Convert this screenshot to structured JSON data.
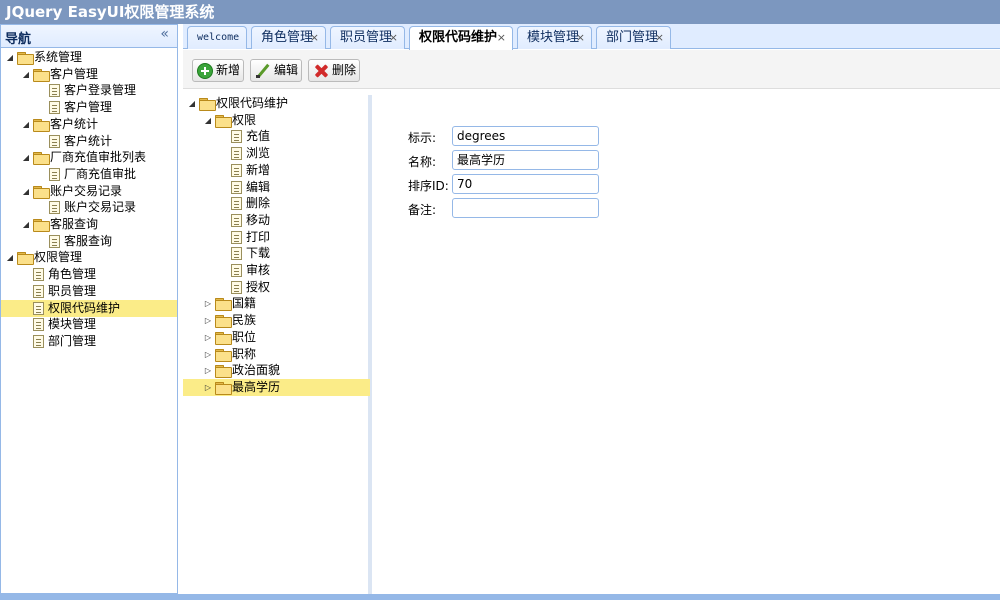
{
  "app": {
    "title": "JQuery EasyUI权限管理系统"
  },
  "nav": {
    "title": "导航",
    "collapse_icon": "double-chevron-left-icon",
    "tree": [
      {
        "label": "系统管理",
        "level": 0,
        "type": "folder",
        "expanded": true
      },
      {
        "label": "客户管理",
        "level": 1,
        "type": "folder",
        "expanded": true
      },
      {
        "label": "客户登录管理",
        "level": 2,
        "type": "leaf"
      },
      {
        "label": "客户管理",
        "level": 2,
        "type": "leaf"
      },
      {
        "label": "客户统计",
        "level": 1,
        "type": "folder",
        "expanded": true
      },
      {
        "label": "客户统计",
        "level": 2,
        "type": "leaf"
      },
      {
        "label": "厂商充值审批列表",
        "level": 1,
        "type": "folder",
        "expanded": true
      },
      {
        "label": "厂商充值审批",
        "level": 2,
        "type": "leaf"
      },
      {
        "label": "账户交易记录",
        "level": 1,
        "type": "folder",
        "expanded": true
      },
      {
        "label": "账户交易记录",
        "level": 2,
        "type": "leaf"
      },
      {
        "label": "客服查询",
        "level": 1,
        "type": "folder",
        "expanded": true
      },
      {
        "label": "客服查询",
        "level": 2,
        "type": "leaf"
      },
      {
        "label": "权限管理",
        "level": 0,
        "type": "folder",
        "expanded": true
      },
      {
        "label": "角色管理",
        "level": 1,
        "type": "leaf"
      },
      {
        "label": "职员管理",
        "level": 1,
        "type": "leaf"
      },
      {
        "label": "权限代码维护",
        "level": 1,
        "type": "leaf",
        "selected": true
      },
      {
        "label": "模块管理",
        "level": 1,
        "type": "leaf"
      },
      {
        "label": "部门管理",
        "level": 1,
        "type": "leaf"
      }
    ]
  },
  "tabs": [
    {
      "label": "welcome",
      "closable": false
    },
    {
      "label": "角色管理",
      "closable": true
    },
    {
      "label": "职员管理",
      "closable": true
    },
    {
      "label": "权限代码维护",
      "closable": true,
      "active": true
    },
    {
      "label": "模块管理",
      "closable": true
    },
    {
      "label": "部门管理",
      "closable": true
    }
  ],
  "tab_close_symbol": "×",
  "toolbar": {
    "add_label": "新增",
    "edit_label": "编辑",
    "delete_label": "删除"
  },
  "code_tree": [
    {
      "label": "权限代码维护",
      "level": 0,
      "type": "folder",
      "expanded": true
    },
    {
      "label": "权限",
      "level": 1,
      "type": "folder",
      "expanded": true
    },
    {
      "label": "充值",
      "level": 2,
      "type": "leaf"
    },
    {
      "label": "浏览",
      "level": 2,
      "type": "leaf"
    },
    {
      "label": "新增",
      "level": 2,
      "type": "leaf"
    },
    {
      "label": "编辑",
      "level": 2,
      "type": "leaf"
    },
    {
      "label": "删除",
      "level": 2,
      "type": "leaf"
    },
    {
      "label": "移动",
      "level": 2,
      "type": "leaf"
    },
    {
      "label": "打印",
      "level": 2,
      "type": "leaf"
    },
    {
      "label": "下载",
      "level": 2,
      "type": "leaf"
    },
    {
      "label": "审核",
      "level": 2,
      "type": "leaf"
    },
    {
      "label": "授权",
      "level": 2,
      "type": "leaf"
    },
    {
      "label": "国籍",
      "level": 1,
      "type": "folder",
      "expanded": false
    },
    {
      "label": "民族",
      "level": 1,
      "type": "folder",
      "expanded": false
    },
    {
      "label": "职位",
      "level": 1,
      "type": "folder",
      "expanded": false
    },
    {
      "label": "职称",
      "level": 1,
      "type": "folder",
      "expanded": false
    },
    {
      "label": "政治面貌",
      "level": 1,
      "type": "folder",
      "expanded": false
    },
    {
      "label": "最高学历",
      "level": 1,
      "type": "folder",
      "expanded": false,
      "selected": true
    }
  ],
  "form": {
    "fields": [
      {
        "label": "标示:",
        "value": "degrees"
      },
      {
        "label": "名称:",
        "value": "最高学历"
      },
      {
        "label": "排序ID:",
        "value": "70"
      },
      {
        "label": "备注:",
        "value": ""
      }
    ]
  },
  "colors": {
    "titlebar": "#7c97bf",
    "border": "#95b8e7",
    "selection": "#fbec88",
    "tab_bg": "#e0ecff"
  }
}
